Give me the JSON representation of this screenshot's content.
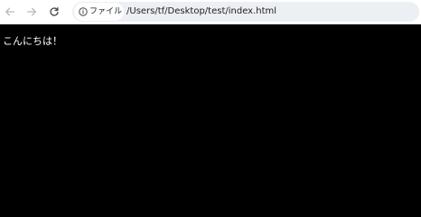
{
  "toolbar": {
    "back_icon": "arrow-left-icon",
    "forward_icon": "arrow-right-icon",
    "reload_icon": "reload-icon"
  },
  "address_bar": {
    "site_info_icon": "info-circle-icon",
    "site_info_label": "ファイル",
    "url": "/Users/tf/Desktop/test/index.html"
  },
  "page": {
    "text": "こんにちは！",
    "background_color": "#000000",
    "text_color": "#ffffff"
  }
}
